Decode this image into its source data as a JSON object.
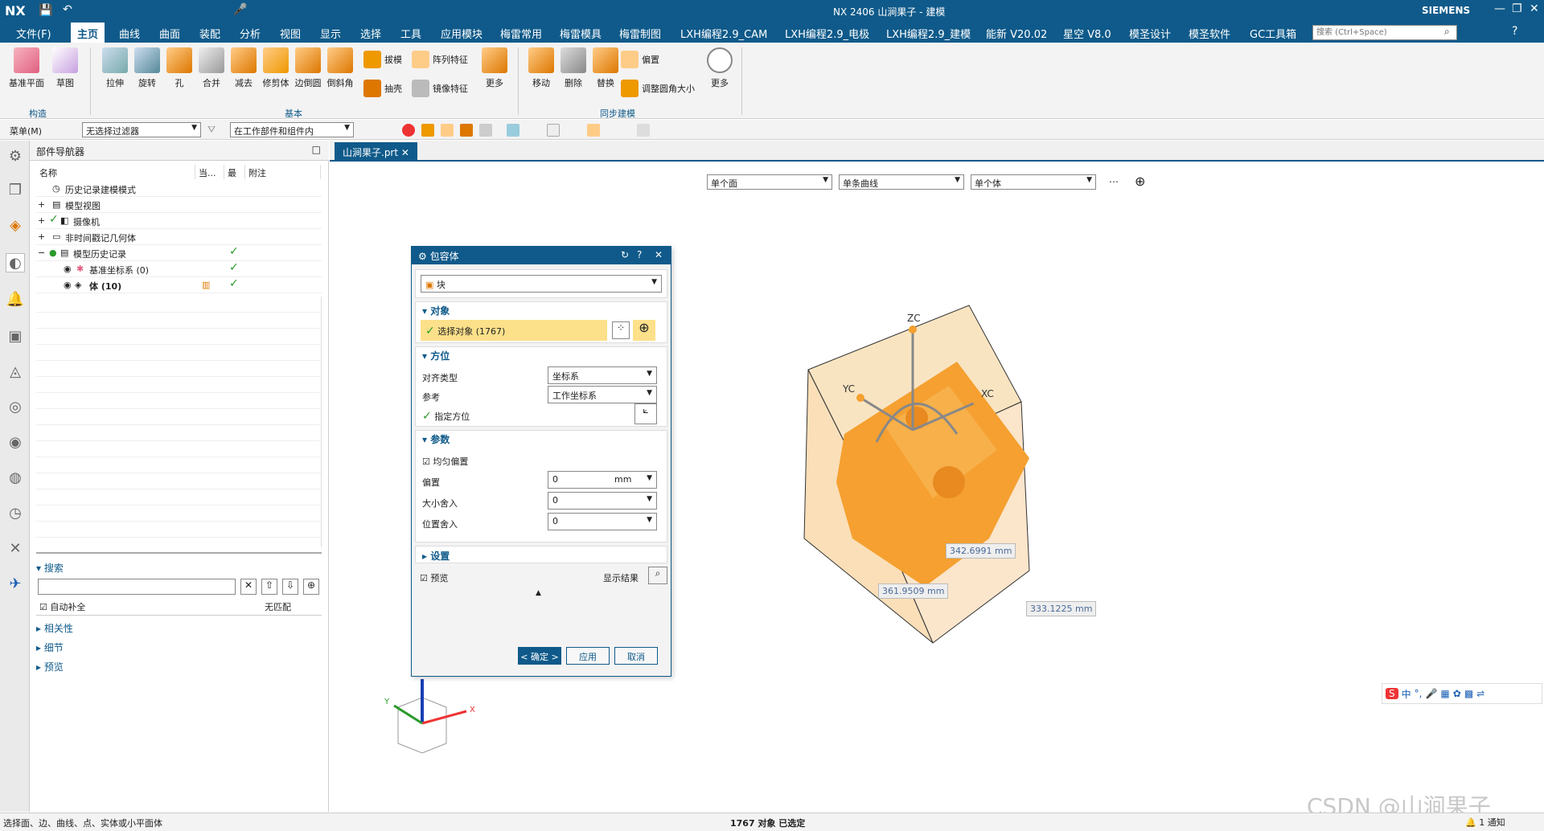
{
  "titlebar": {
    "app": "NX",
    "title": "NX 2406 山涧果子 - 建模",
    "brand": "SIEMENS"
  },
  "menu": {
    "file": "文件(F)",
    "items": [
      "主页",
      "曲线",
      "曲面",
      "装配",
      "分析",
      "视图",
      "显示",
      "选择",
      "工具",
      "应用模块",
      "梅雷常用",
      "梅雷模具",
      "梅雷制图",
      "LXH编程2.9_CAM",
      "LXH编程2.9_电极",
      "LXH编程2.9_建模",
      "能新 V20.02",
      "星空 V8.0",
      "模圣设计",
      "模圣软件",
      "GC工具箱"
    ],
    "search_placeholder": "搜索 (Ctrl+Space)"
  },
  "ribbon": {
    "construct": [
      "基准平面",
      "草图"
    ],
    "construct_group": "构造",
    "basic": [
      "拉伸",
      "旋转",
      "孔",
      "合并",
      "减去",
      "修剪体",
      "边倒圆",
      "倒斜角"
    ],
    "basic_small": [
      "拔模",
      "抽壳",
      "阵列特征",
      "镜像特征"
    ],
    "basic_more": "更多",
    "basic_group": "基本",
    "sync": [
      "移动",
      "删除",
      "替换"
    ],
    "sync_small": [
      "偏置",
      "调整圆角大小"
    ],
    "sync_more": "更多",
    "sync_group": "同步建模"
  },
  "toolbar2": {
    "menu": "菜单(M)",
    "filter": "无选择过滤器",
    "scope": "在工作部件和组件内"
  },
  "navigator": {
    "title": "部件导航器",
    "columns": [
      "名称",
      "当...",
      "最",
      "附注"
    ],
    "rows": [
      "历史记录建模模式",
      "模型视图",
      "摄像机",
      "非时间戳记几何体",
      "模型历史记录",
      "基准坐标系 (0)",
      "体 (10)"
    ],
    "search": "搜索",
    "auto_complete": "自动补全",
    "no_match": "无匹配",
    "sections": [
      "相关性",
      "细节",
      "预览"
    ]
  },
  "graphics": {
    "tab": "山涧果子.prt",
    "sel1": "单个面",
    "sel2": "单条曲线",
    "sel3": "单个体"
  },
  "dialog": {
    "title": "包容体",
    "type": "块",
    "object_section": "对象",
    "select_object": "选择对象 (1767)",
    "orient_section": "方位",
    "align_label": "对齐类型",
    "align_value": "坐标系",
    "ref_label": "参考",
    "ref_value": "工作坐标系",
    "specify": "指定方位",
    "param_section": "参数",
    "uniform": "均匀偏置",
    "offset_label": "偏置",
    "offset_value": "0",
    "unit": "mm",
    "size_round": "大小舍入",
    "size_value": "0",
    "pos_round": "位置舍入",
    "pos_value": "0",
    "settings": "设置",
    "preview": "预览",
    "show_result": "显示结果",
    "ok": "< 确定 >",
    "apply": "应用",
    "cancel": "取消"
  },
  "dims": {
    "d1": "342.6991 mm",
    "d2": "361.9509 mm",
    "d3": "333.1225 mm",
    "zc": "ZC",
    "yc": "YC",
    "xc": "XC"
  },
  "axis": {
    "x": "X",
    "y": "Y"
  },
  "status": {
    "left": "选择面、边、曲线、点、实体或小平面体",
    "center": "1767 对象 已选定",
    "notify": "1 通知"
  },
  "watermark": "CSDN @山涧果子",
  "ime": {
    "zh": "中"
  },
  "colors": {
    "accent": "#0f5a8a",
    "model": "#f5a030",
    "box": "#f7d9a8"
  }
}
